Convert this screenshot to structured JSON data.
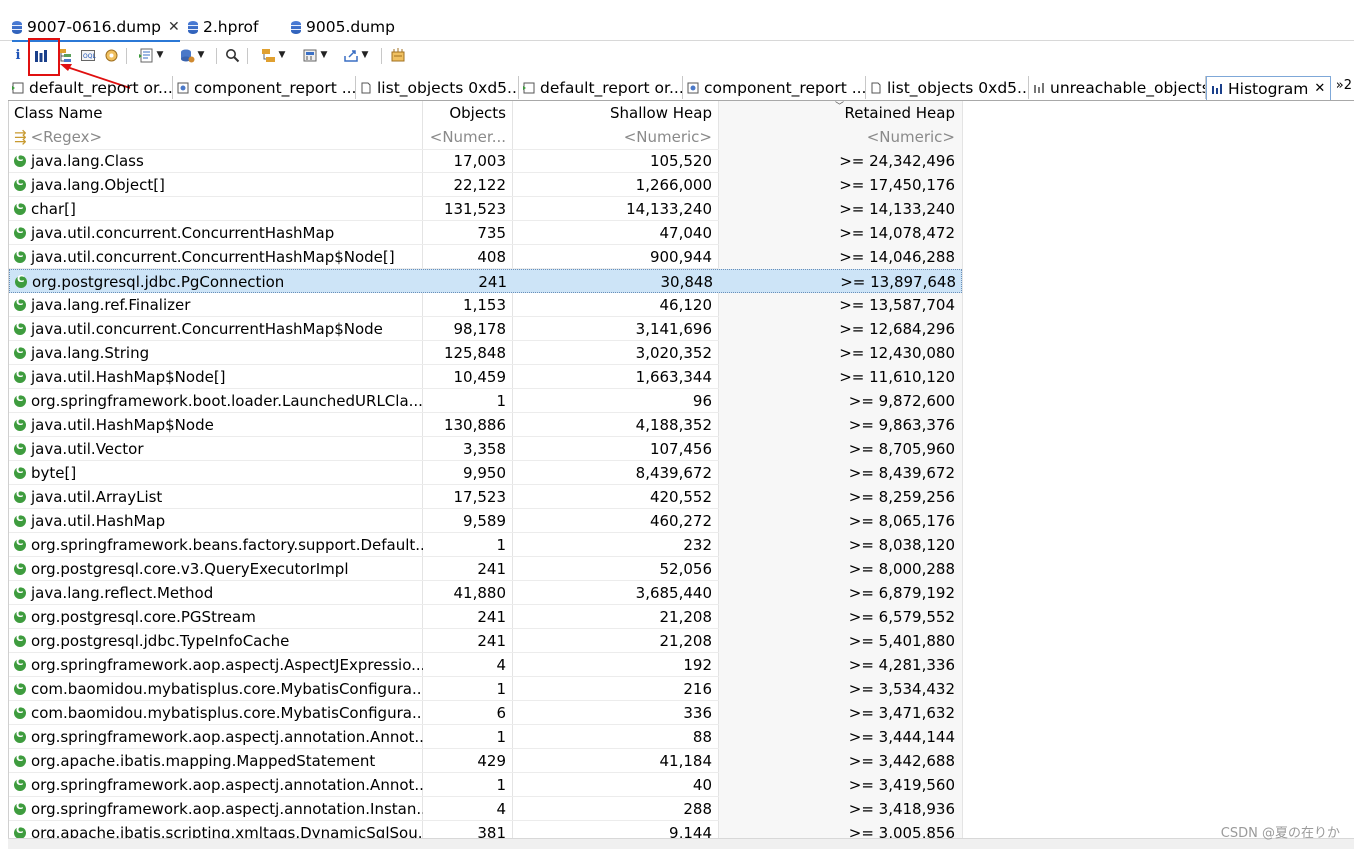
{
  "editor_tabs": [
    {
      "label": "9007-0616.dump",
      "active": true
    },
    {
      "label": "2.hprof",
      "active": false
    },
    {
      "label": "9005.dump",
      "active": false
    }
  ],
  "toolbar": {
    "info_glyph": "i",
    "icons": [
      "info-icon",
      "histogram-icon",
      "dominator-tree-icon",
      "oql-icon",
      "heap-dump-overview-icon",
      "run-report-icon",
      "query-browser-icon",
      "search-icon",
      "group-result-icon",
      "calculate-retained-icon",
      "export-icon",
      "find-leaks-icon"
    ]
  },
  "result_tabs": [
    {
      "label": "default_report or...",
      "icon": "report-icon"
    },
    {
      "label": "component_report ...",
      "icon": "component-icon"
    },
    {
      "label": "list_objects 0xd5...",
      "icon": "list-icon"
    },
    {
      "label": "default_report or...",
      "icon": "report-icon"
    },
    {
      "label": "component_report ...",
      "icon": "component-icon"
    },
    {
      "label": "list_objects 0xd5...",
      "icon": "list-icon"
    },
    {
      "label": "unreachable_objects",
      "icon": "histogram-icon"
    },
    {
      "label": "Histogram",
      "icon": "histogram-icon",
      "active": true
    }
  ],
  "more_tabs": "»2",
  "columns": [
    "Class Name",
    "Objects",
    "Shallow Heap",
    "Retained Heap"
  ],
  "filters": [
    "<Regex>",
    "<Numer...",
    "<Numeric>",
    "<Numeric>"
  ],
  "rows": [
    [
      "java.lang.Class",
      "17,003",
      "105,520",
      ">= 24,342,496"
    ],
    [
      "java.lang.Object[]",
      "22,122",
      "1,266,000",
      ">= 17,450,176"
    ],
    [
      "char[]",
      "131,523",
      "14,133,240",
      ">= 14,133,240"
    ],
    [
      "java.util.concurrent.ConcurrentHashMap",
      "735",
      "47,040",
      ">= 14,078,472"
    ],
    [
      "java.util.concurrent.ConcurrentHashMap$Node[]",
      "408",
      "900,944",
      ">= 14,046,288"
    ],
    [
      "org.postgresql.jdbc.PgConnection",
      "241",
      "30,848",
      ">= 13,897,648"
    ],
    [
      "java.lang.ref.Finalizer",
      "1,153",
      "46,120",
      ">= 13,587,704"
    ],
    [
      "java.util.concurrent.ConcurrentHashMap$Node",
      "98,178",
      "3,141,696",
      ">= 12,684,296"
    ],
    [
      "java.lang.String",
      "125,848",
      "3,020,352",
      ">= 12,430,080"
    ],
    [
      "java.util.HashMap$Node[]",
      "10,459",
      "1,663,344",
      ">= 11,610,120"
    ],
    [
      "org.springframework.boot.loader.LaunchedURLCla...",
      "1",
      "96",
      ">= 9,872,600"
    ],
    [
      "java.util.HashMap$Node",
      "130,886",
      "4,188,352",
      ">= 9,863,376"
    ],
    [
      "java.util.Vector",
      "3,358",
      "107,456",
      ">= 8,705,960"
    ],
    [
      "byte[]",
      "9,950",
      "8,439,672",
      ">= 8,439,672"
    ],
    [
      "java.util.ArrayList",
      "17,523",
      "420,552",
      ">= 8,259,256"
    ],
    [
      "java.util.HashMap",
      "9,589",
      "460,272",
      ">= 8,065,176"
    ],
    [
      "org.springframework.beans.factory.support.Default...",
      "1",
      "232",
      ">= 8,038,120"
    ],
    [
      "org.postgresql.core.v3.QueryExecutorImpl",
      "241",
      "52,056",
      ">= 8,000,288"
    ],
    [
      "java.lang.reflect.Method",
      "41,880",
      "3,685,440",
      ">= 6,879,192"
    ],
    [
      "org.postgresql.core.PGStream",
      "241",
      "21,208",
      ">= 6,579,552"
    ],
    [
      "org.postgresql.jdbc.TypeInfoCache",
      "241",
      "21,208",
      ">= 5,401,880"
    ],
    [
      "org.springframework.aop.aspectj.AspectJExpressio...",
      "4",
      "192",
      ">= 4,281,336"
    ],
    [
      "com.baomidou.mybatisplus.core.MybatisConfigura...",
      "1",
      "216",
      ">= 3,534,432"
    ],
    [
      "com.baomidou.mybatisplus.core.MybatisConfigura...",
      "6",
      "336",
      ">= 3,471,632"
    ],
    [
      "org.springframework.aop.aspectj.annotation.Annot...",
      "1",
      "88",
      ">= 3,444,144"
    ],
    [
      "org.apache.ibatis.mapping.MappedStatement",
      "429",
      "41,184",
      ">= 3,442,688"
    ],
    [
      "org.springframework.aop.aspectj.annotation.Annot...",
      "1",
      "40",
      ">= 3,419,560"
    ],
    [
      "org.springframework.aop.aspectj.annotation.Instan...",
      "4",
      "288",
      ">= 3,418,936"
    ],
    [
      "org.apache.ibatis.scripting.xmltags.DynamicSqlSou...",
      "381",
      "9,144",
      ">= 3,005,856"
    ]
  ],
  "selected_row": 5,
  "watermark": "CSDN @夏の在りか",
  "colors": {
    "accent": "#2b78d6",
    "highlight_box": "#e01010",
    "selection": "#cde4f7",
    "class_icon": "#3e9c3e"
  }
}
